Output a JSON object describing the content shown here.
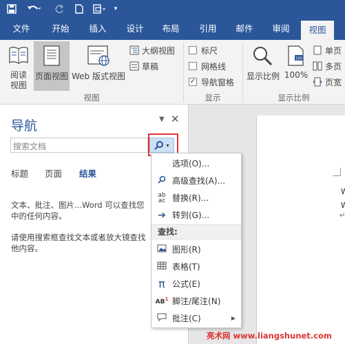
{
  "tabs": [
    "文件",
    "开始",
    "插入",
    "设计",
    "布局",
    "引用",
    "邮件",
    "审阅",
    "视图"
  ],
  "ribbon": {
    "views_group": {
      "label": "视图",
      "read_mode": "阅读\n视图",
      "print_layout": "页面视图",
      "web_layout": "Web 版式视图",
      "outline": "大纲视图",
      "draft": "草稿"
    },
    "show_group": {
      "label": "显示",
      "ruler": "标尺",
      "gridlines": "网格线",
      "nav_pane": "导航窗格",
      "nav_pane_checked": true
    },
    "zoom_group": {
      "label": "显示比例",
      "zoom": "显示比例",
      "hundred": "100%",
      "one_page": "单页",
      "multi_page": "多页",
      "page_width": "页宽"
    }
  },
  "nav": {
    "title": "导航",
    "search_placeholder": "搜索文档",
    "tabs": [
      "标题",
      "页面",
      "结果"
    ],
    "active_tab": "结果",
    "desc1": "文本、批注、图片...Word 可以查找您",
    "desc1b": "中的任何内容。",
    "desc2": "请使用搜索框查找文本或者放大镜查找",
    "desc2b": "他内容。"
  },
  "menu": {
    "items": [
      {
        "icon": "",
        "label": "选项(O)..."
      },
      {
        "icon": "magnifier-icon",
        "label": "高级查找(A)..."
      },
      {
        "icon": "replace-icon",
        "label": "替换(R)..."
      },
      {
        "icon": "arrow-right-icon",
        "label": "转到(G)..."
      }
    ],
    "section": "查找:",
    "find_items": [
      {
        "icon": "graphics-icon",
        "label": "图形(R)"
      },
      {
        "icon": "table-icon",
        "label": "表格(T)"
      },
      {
        "icon": "pi-icon",
        "label": "公式(E)"
      },
      {
        "icon": "footnote-icon",
        "label": "脚注/尾注(N)"
      },
      {
        "icon": "comment-icon",
        "label": "批注(C)"
      }
    ]
  },
  "doc": {
    "line1": "W",
    "line2": "W",
    "mark": "↵"
  },
  "watermark": "亮术网 www.liangshunet.com"
}
